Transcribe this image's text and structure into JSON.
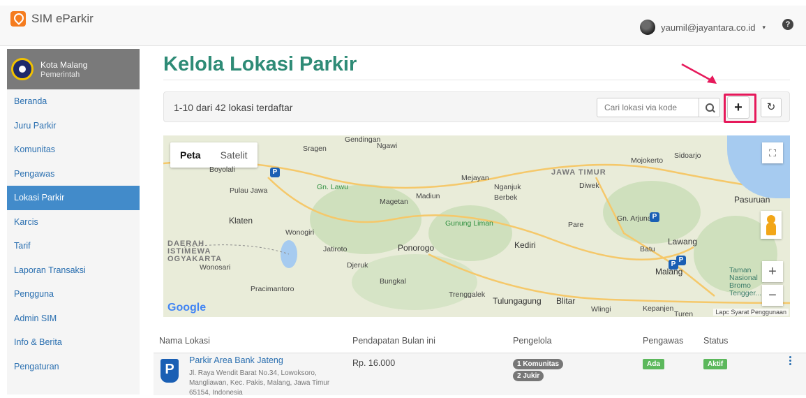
{
  "app": {
    "name": "SIM eParkir"
  },
  "user": {
    "email": "yaumil@jayantara.co.id",
    "caret": "▾",
    "help": "?"
  },
  "org": {
    "name": "Kota Malang",
    "type": "Pemerintah"
  },
  "sidebar": {
    "items": [
      {
        "label": "Beranda",
        "active": false
      },
      {
        "label": "Juru Parkir",
        "active": false
      },
      {
        "label": "Komunitas",
        "active": false
      },
      {
        "label": "Pengawas",
        "active": false
      },
      {
        "label": "Lokasi Parkir",
        "active": true
      },
      {
        "label": "Karcis",
        "active": false
      },
      {
        "label": "Tarif",
        "active": false
      },
      {
        "label": "Laporan Transaksi",
        "active": false
      },
      {
        "label": "Pengguna",
        "active": false
      },
      {
        "label": "Admin SIM",
        "active": false
      },
      {
        "label": "Info & Berita",
        "active": false
      },
      {
        "label": "Pengaturan",
        "active": false
      }
    ]
  },
  "page": {
    "title": "Kelola Lokasi Parkir"
  },
  "toolbar": {
    "count_text": "1-10 dari 42 lokasi terdaftar",
    "search_placeholder": "Cari lokasi via kode",
    "add_label": "+",
    "refresh_label": "↻"
  },
  "map": {
    "tabs": [
      "Peta",
      "Satelit"
    ],
    "labels": [
      {
        "text": "Sragen",
        "cls": ""
      },
      {
        "text": "Boyolali",
        "cls": ""
      },
      {
        "text": "Gn. Lawu",
        "cls": "green"
      },
      {
        "text": "Mejayan",
        "cls": ""
      },
      {
        "text": "Nganjuk",
        "cls": ""
      },
      {
        "text": "Berbek",
        "cls": ""
      },
      {
        "text": "JAWA TIMUR",
        "cls": "region"
      },
      {
        "text": "Diwek",
        "cls": ""
      },
      {
        "text": "Mojokerto",
        "cls": ""
      },
      {
        "text": "Sidoarjo",
        "cls": ""
      },
      {
        "text": "Pulau Jawa",
        "cls": ""
      },
      {
        "text": "Madiun",
        "cls": ""
      },
      {
        "text": "Magetan",
        "cls": ""
      },
      {
        "text": "Pasuruan",
        "cls": "big"
      },
      {
        "text": "Klaten",
        "cls": "big"
      },
      {
        "text": "Wonogiri",
        "cls": ""
      },
      {
        "text": "Gunung Liman",
        "cls": "green"
      },
      {
        "text": "Pare",
        "cls": ""
      },
      {
        "text": "Gn. Arjuna",
        "cls": ""
      },
      {
        "text": "DAERAH ISTIMEWA OGYAKARTA",
        "cls": "region"
      },
      {
        "text": "Jatiroto",
        "cls": ""
      },
      {
        "text": "Ponorogo",
        "cls": "big"
      },
      {
        "text": "Kediri",
        "cls": "big"
      },
      {
        "text": "Lawang",
        "cls": "big"
      },
      {
        "text": "Batu",
        "cls": ""
      },
      {
        "text": "Wonosari",
        "cls": ""
      },
      {
        "text": "Djeruk",
        "cls": ""
      },
      {
        "text": "Malang",
        "cls": "big"
      },
      {
        "text": "Taman Nasional Bromo Tengger...",
        "cls": "teal"
      },
      {
        "text": "Bungkal",
        "cls": ""
      },
      {
        "text": "Pracimantoro",
        "cls": ""
      },
      {
        "text": "Trenggalek",
        "cls": ""
      },
      {
        "text": "Tulungagung",
        "cls": "big"
      },
      {
        "text": "Blitar",
        "cls": "big"
      },
      {
        "text": "Wlingi",
        "cls": ""
      },
      {
        "text": "Kepanjen",
        "cls": ""
      },
      {
        "text": "Turen",
        "cls": ""
      },
      {
        "text": "Gendingan",
        "cls": ""
      },
      {
        "text": "Ngawi",
        "cls": ""
      }
    ],
    "google": "Google",
    "attribution": "Lapc Syarat Penggunaan"
  },
  "table": {
    "headers": [
      "Nama Lokasi",
      "Pendapatan Bulan ini",
      "Pengelola",
      "Pengawas",
      "Status"
    ],
    "rows": [
      {
        "name": "Parkir Area Bank Jateng",
        "address": "Jl. Raya Wendit Barat No.34, Lowoksoro, Mangliawan, Kec. Pakis, Malang, Jawa Timur 65154, Indonesia",
        "income": "Rp. 16.000",
        "komunitas": "1 Komunitas",
        "jukir": "2 Jukir",
        "pengawas": "Ada",
        "status": "Aktif"
      }
    ]
  },
  "colors": {
    "accent": "#428bca",
    "title": "#2e8b76",
    "highlight": "#e6195b",
    "pin": "#1a5fb4",
    "brand": "#f57c1f"
  }
}
